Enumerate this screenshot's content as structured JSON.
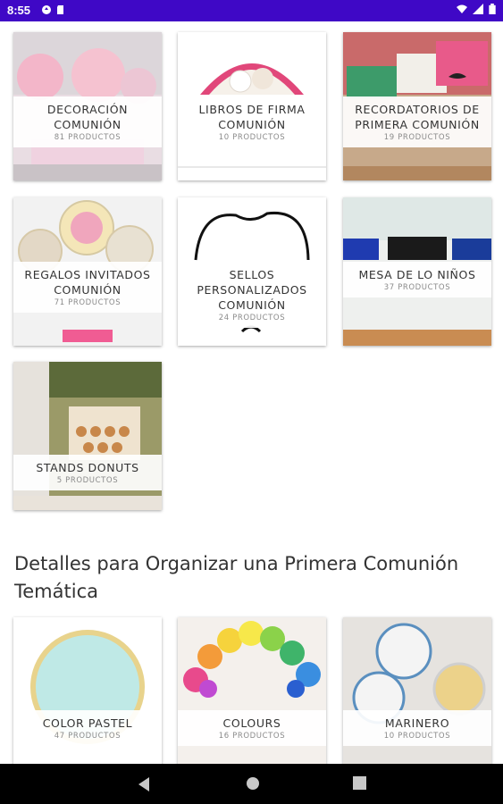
{
  "status_bar": {
    "time": "8:55",
    "left_icons": [
      "sync-icon",
      "sd-card-icon"
    ],
    "right_icons": [
      "wifi-icon",
      "signal-icon",
      "battery-icon"
    ],
    "color": "#3f08c6"
  },
  "categories": [
    {
      "title": "DECORACIÓN COMUNIÓN",
      "count": "81 PRODUCTOS"
    },
    {
      "title": "LIBROS DE FIRMA COMUNIÓN",
      "count": "10 PRODUCTOS"
    },
    {
      "title": "RECORDATORIOS DE PRIMERA COMUNIÓN",
      "count": "19 PRODUCTOS"
    },
    {
      "title": "REGALOS INVITADOS COMUNIÓN",
      "count": "71 PRODUCTOS"
    },
    {
      "title": "SELLOS PERSONALIZADOS COMUNIÓN",
      "count": "24 PRODUCTOS"
    },
    {
      "title": "MESA DE LO NIÑOS",
      "count": "37 PRODUCTOS"
    },
    {
      "title": "STANDS DONUTS",
      "count": "5 PRODUCTOS"
    }
  ],
  "section_title": "Detalles para Organizar una Primera Comunión Temática",
  "themes": [
    {
      "title": "COLOR PASTEL",
      "count": "47 PRODUCTOS"
    },
    {
      "title": "COLOURS",
      "count": "16 PRODUCTOS"
    },
    {
      "title": "MARINERO",
      "count": "10 PRODUCTOS"
    }
  ],
  "nav_bar": {
    "buttons": [
      "back-icon",
      "home-icon",
      "recents-icon"
    ]
  }
}
